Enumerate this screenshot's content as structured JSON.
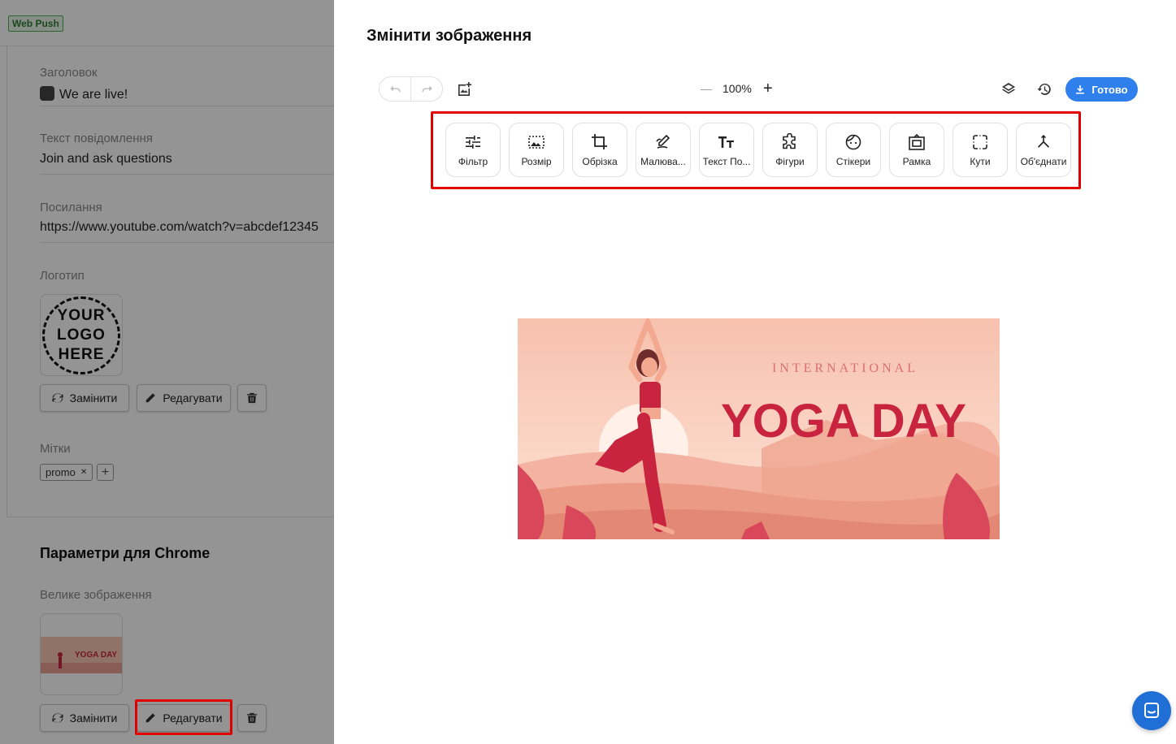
{
  "left_panel": {
    "badge": "Web Push",
    "fields": {
      "title_label": "Заголовок",
      "title_value": "We are live!",
      "message_label": "Текст повідомлення",
      "message_value": "Join and ask questions",
      "link_label": "Посилання",
      "link_value": "https://www.youtube.com/watch?v=abcdef12345",
      "logo_label": "Логотип",
      "logo_text": [
        "YOUR",
        "LOGO",
        "HERE"
      ],
      "tags_label": "Мітки",
      "tags": [
        "promo"
      ],
      "tag_remove": "✕",
      "tag_add": "+"
    },
    "buttons": {
      "replace": "Замінити",
      "edit": "Редагувати"
    },
    "chrome_section": {
      "title": "Параметри для Chrome",
      "big_image_label": "Велике зображення"
    }
  },
  "editor": {
    "title": "Змінити зображення",
    "zoom": "100%",
    "zoom_minus": "—",
    "zoom_plus": "+",
    "done_label": "Готово",
    "tools": [
      {
        "label": "Фільтр",
        "icon": "filter-icon"
      },
      {
        "label": "Розмір",
        "icon": "resize-icon"
      },
      {
        "label": "Обрізка",
        "icon": "crop-icon"
      },
      {
        "label": "Малюва...",
        "icon": "draw-icon"
      },
      {
        "label": "Текст По...",
        "icon": "text-icon"
      },
      {
        "label": "Фігури",
        "icon": "shapes-icon"
      },
      {
        "label": "Стікери",
        "icon": "stickers-icon"
      },
      {
        "label": "Рамка",
        "icon": "frame-icon"
      },
      {
        "label": "Кути",
        "icon": "corners-icon"
      },
      {
        "label": "Об'єднати",
        "icon": "merge-icon"
      }
    ],
    "image": {
      "subtitle": "INTERNATIONAL",
      "headline": "YOGA DAY"
    }
  },
  "colors": {
    "accent": "#2f80ed",
    "highlight": "#e10000",
    "yoga_red": "#c8243f"
  }
}
